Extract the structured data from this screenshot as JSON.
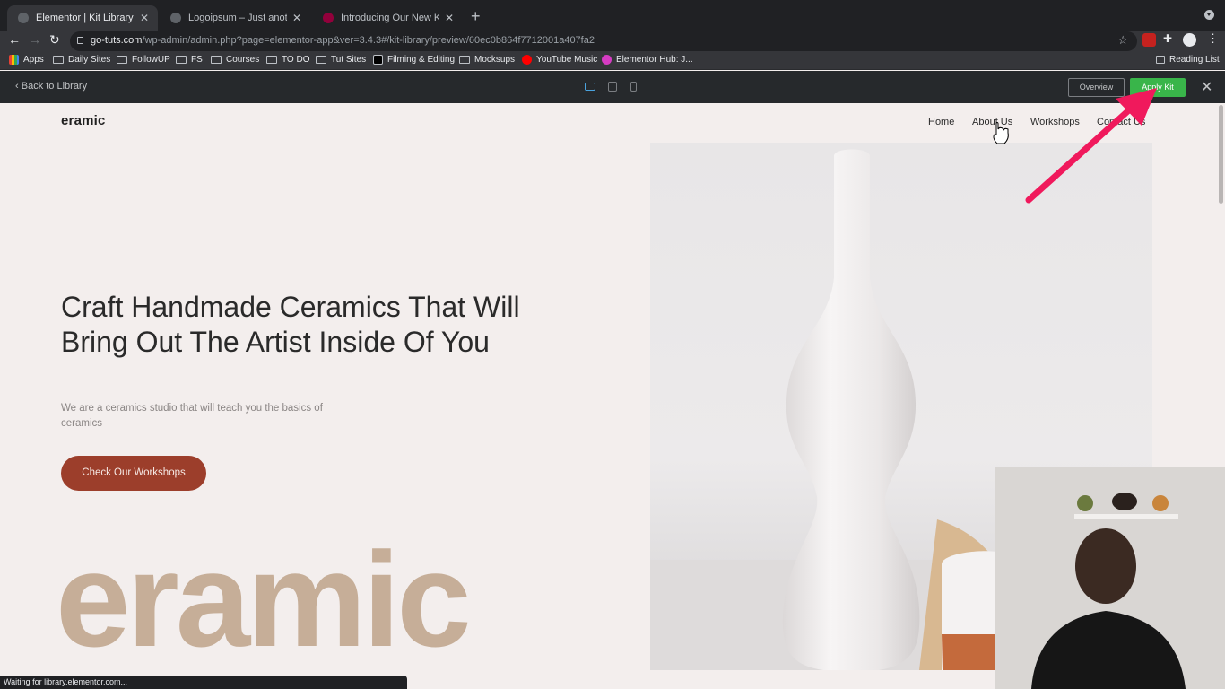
{
  "browser": {
    "tabs": [
      {
        "title": "Elementor | Kit Library | Ceram",
        "favicon_color": "#5f6368"
      },
      {
        "title": "Logoipsum – Just another Wor",
        "favicon_color": "#5f6368"
      },
      {
        "title": "Introducing Our New Kits Libra",
        "favicon_color": "#92003b"
      }
    ],
    "url_domain": "go-tuts.com",
    "url_path": "/wp-admin/admin.php?page=elementor-app&ver=3.4.3#/kit-library/preview/60ec0b864f7712001a407fa2",
    "bookmarks": [
      "Apps",
      "Daily Sites",
      "FollowUP",
      "FS",
      "Courses",
      "TO DO",
      "Tut Sites",
      "Filming & Editing",
      "Mocksups",
      "YouTube Music",
      "Elementor Hub: J..."
    ],
    "reading_list": "Reading List",
    "status_text": "Waiting for library.elementor.com..."
  },
  "elementor_bar": {
    "back_label": "Back to Library",
    "overview_label": "Overview",
    "apply_label": "Apply Kit",
    "accent_color": "#39b54a"
  },
  "site": {
    "logo": "eramic",
    "menu": [
      "Home",
      "About Us",
      "Workshops",
      "Contact Us"
    ],
    "hero_title": "Craft Handmade Ceramics That Will Bring Out The Artist Inside Of You",
    "hero_subtitle": "We are a ceramics studio that will teach you the basics of ceramics",
    "cta_label": "Check Our Workshops",
    "big_word": "eramic",
    "brand_color": "#9c3e2b",
    "accent_tan": "#c6ae98"
  },
  "annotation": {
    "arrow_color": "#f0195c"
  }
}
